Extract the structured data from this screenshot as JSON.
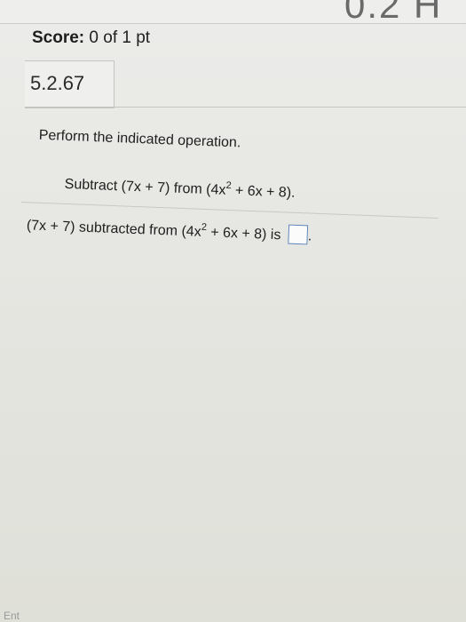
{
  "header": {
    "section_title": "0.2 H"
  },
  "score": {
    "label": "Score:",
    "value": "0 of 1 pt"
  },
  "question": {
    "number": "5.2.67",
    "instruction": "Perform the indicated operation.",
    "problem": {
      "prefix": "Subtract (7x + 7) from (4x",
      "exponent": "2",
      "suffix": " + 6x + 8)."
    },
    "answer_prompt": {
      "prefix": "(7x + 7) subtracted from (4x",
      "exponent": "2",
      "suffix": " + 6x + 8) is",
      "after_box": "."
    }
  },
  "footer": {
    "partial_text": "Ent"
  }
}
